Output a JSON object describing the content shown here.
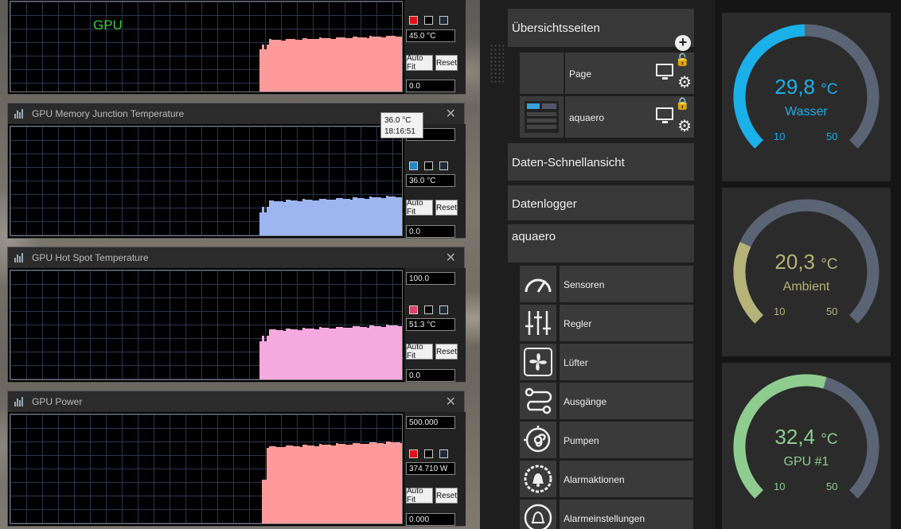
{
  "graphs": [
    {
      "title": "",
      "overlay_label": "GPU",
      "color": "#ff9a9a",
      "swatch_color": "#e0101a",
      "top_value": "",
      "current_value": "45.0 °C",
      "bottom_value": "0.0",
      "auto_fit_label": "Auto Fit",
      "reset_label": "Reset",
      "level_fraction": 0.62
    },
    {
      "title": "GPU Memory Junction Temperature",
      "color": "#9db6f2",
      "swatch_color": "#1f88cc",
      "top_value": "",
      "current_value": "36.0 °C",
      "bottom_value": "0.0",
      "auto_fit_label": "Auto Fit",
      "reset_label": "Reset",
      "level_fraction": 0.36
    },
    {
      "title": "GPU Hot Spot Temperature",
      "color": "#f6a9de",
      "swatch_color": "#e0406a",
      "top_value": "100.0",
      "current_value": "51.3 °C",
      "bottom_value": "0.0",
      "auto_fit_label": "Auto Fit",
      "reset_label": "Reset",
      "level_fraction": 0.5
    },
    {
      "title": "GPU Power",
      "color": "#ff9a9a",
      "swatch_color": "#e0101a",
      "top_value": "500.000",
      "current_value": "374.710 W",
      "bottom_value": "0.000",
      "auto_fit_label": "Auto Fit",
      "reset_label": "Reset",
      "level_fraction": 0.75
    }
  ],
  "tooltip": {
    "value": "36.0 °C",
    "time": "18:16:51"
  },
  "aquasuite": {
    "overview_pages_label": "Übersichtsseiten",
    "pages": [
      {
        "name": "Page",
        "locked": false
      },
      {
        "name": "aquaero",
        "locked": true
      }
    ],
    "quick_view_label": "Daten-Schnellansicht",
    "datalogger_label": "Datenlogger",
    "device_label": "aquaero",
    "device_items": [
      {
        "label": "Sensoren",
        "icon": "gauge-icon"
      },
      {
        "label": "Regler",
        "icon": "sliders-icon"
      },
      {
        "label": "Lüfter",
        "icon": "fan-icon"
      },
      {
        "label": "Ausgänge",
        "icon": "outputs-icon"
      },
      {
        "label": "Pumpen",
        "icon": "pump-icon"
      },
      {
        "label": "Alarmaktionen",
        "icon": "alarm-bell-icon"
      },
      {
        "label": "Alarmeinstellungen",
        "icon": "alarm-settings-icon"
      }
    ]
  },
  "gauges": [
    {
      "value": "29,8",
      "unit": "°C",
      "name": "Wasser",
      "min": "10",
      "max": "50",
      "fraction": 0.495,
      "color": "#1ab0ea"
    },
    {
      "value": "20,3",
      "unit": "°C",
      "name": "Ambient",
      "min": "10",
      "max": "50",
      "fraction": 0.257,
      "color": "#b5b27a"
    },
    {
      "value": "32,4",
      "unit": "°C",
      "name": "GPU #1",
      "min": "10",
      "max": "50",
      "fraction": 0.56,
      "color": "#8fcc8f"
    }
  ],
  "colors": {
    "gauge_track": "#5b6474"
  }
}
